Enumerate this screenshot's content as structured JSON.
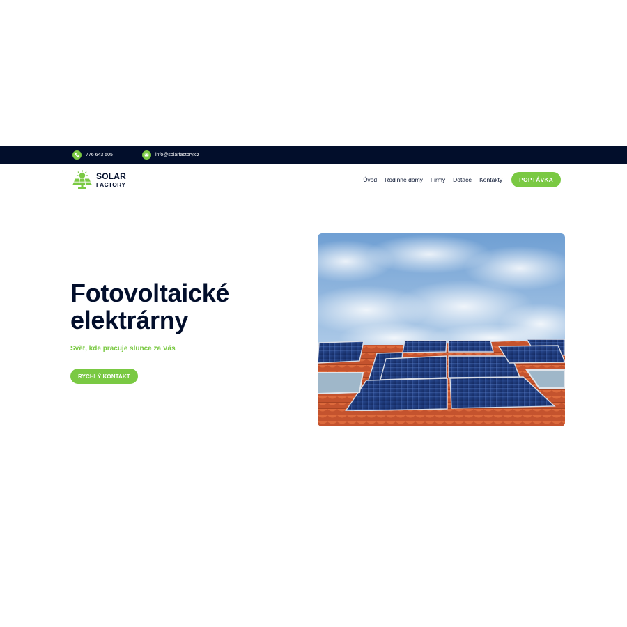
{
  "topbar": {
    "phone": "776 643 505",
    "email": "info@solarfactory.cz",
    "icons": {
      "phone": "phone-icon",
      "email": "email-icon"
    }
  },
  "logo": {
    "line1": "SOLAR",
    "line2": "FACTORY",
    "icon": "solar-panel-sun-icon"
  },
  "nav": {
    "items": [
      "Úvod",
      "Rodinné domy",
      "Firmy",
      "Dotace",
      "Kontakty"
    ],
    "cta": "POPTÁVKA"
  },
  "hero": {
    "title_line1": "Fotovoltaické",
    "title_line2": "elektrárny",
    "subtitle": "Svět, kde pracuje slunce za Vás",
    "button": "RYCHLÝ KONTAKT",
    "image": "solar-panels-on-roof-photo"
  },
  "colors": {
    "accent": "#7ac943",
    "navy": "#020e2b",
    "background": "#ffffff"
  }
}
